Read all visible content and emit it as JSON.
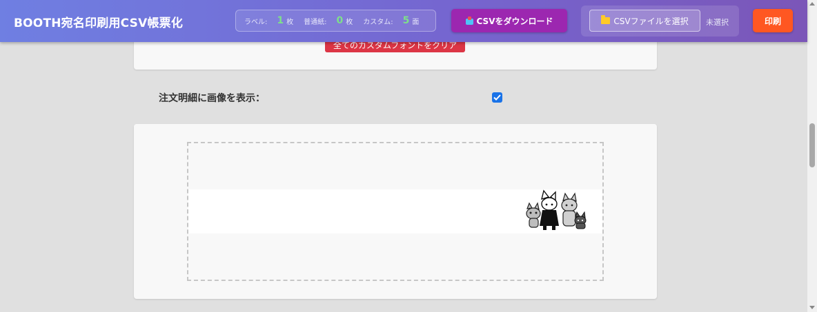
{
  "header": {
    "title": "BOOTH宛名印刷用CSV帳票化",
    "counts": [
      {
        "label": "ラベル:",
        "value": "1",
        "unit": "枚"
      },
      {
        "label": "普通紙:",
        "value": "0",
        "unit": "枚"
      },
      {
        "label": "カスタム:",
        "value": "5",
        "unit": "面"
      }
    ],
    "download_label": "CSVをダウンロード",
    "file_select_label": "CSVファイルを選択",
    "file_status": "未選択",
    "print_label": "印刷"
  },
  "fonts_panel": {
    "clear_button_label": "全てのカスタムフォントをクリア"
  },
  "options": {
    "show_images_label": "注文明細に画像を表示：",
    "show_images_checked": true
  },
  "preview": {
    "image_alt": "cat-characters-illustration"
  },
  "colors": {
    "header_start": "#6f7fe2",
    "header_end": "#7b56b8",
    "download_button": "#9c27b0",
    "print_button": "#ff5722",
    "clear_button": "#dc3545",
    "count_value": "#7ee08a",
    "checkbox": "#1a73e8"
  }
}
